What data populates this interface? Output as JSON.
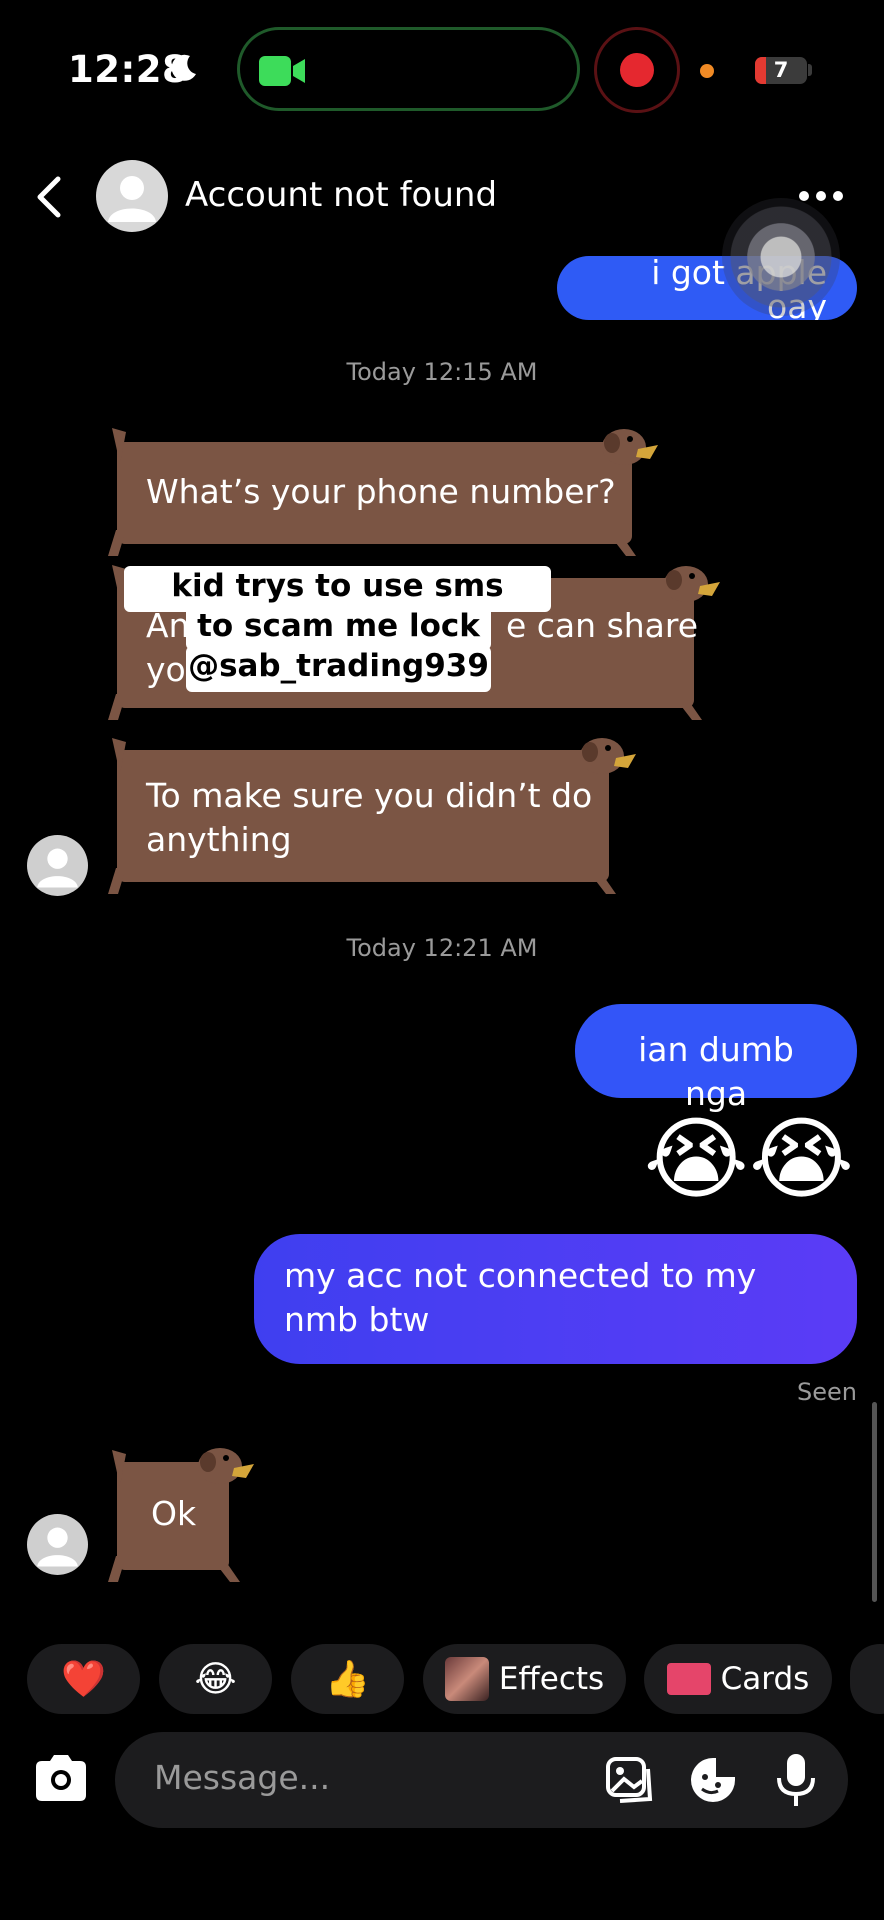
{
  "status_bar": {
    "time": "12:28",
    "battery_level": "7"
  },
  "header": {
    "title": "Account not found"
  },
  "messages": {
    "first_out": "i got apple oay",
    "time1": "Today 12:15 AM",
    "in1": "What’s your phone number?",
    "in2_line1": "An",
    "in2_line1_end": "e can share",
    "in2_line2": "yo",
    "in3": "To make sure you didn’t do anything",
    "time2": "Today 12:21 AM",
    "out2": "ian dumb nga",
    "emoji": "😭😭",
    "out3": "my acc not connected to my nmb btw",
    "seen": "Seen",
    "in4": "Ok"
  },
  "overlay": {
    "line1": "kid trys to use sms method",
    "line2": "to scam me lock in",
    "line3": "@sab_trading939"
  },
  "quick_bar": {
    "heart": "❤️",
    "laugh": "😂",
    "thumbs": "👍",
    "effects_label": "Effects",
    "cards_label": "Cards"
  },
  "composer": {
    "placeholder": "Message..."
  },
  "colors": {
    "out_bubble": "#3355f8",
    "dog_bubble": "#7b5544",
    "background": "#000000"
  }
}
